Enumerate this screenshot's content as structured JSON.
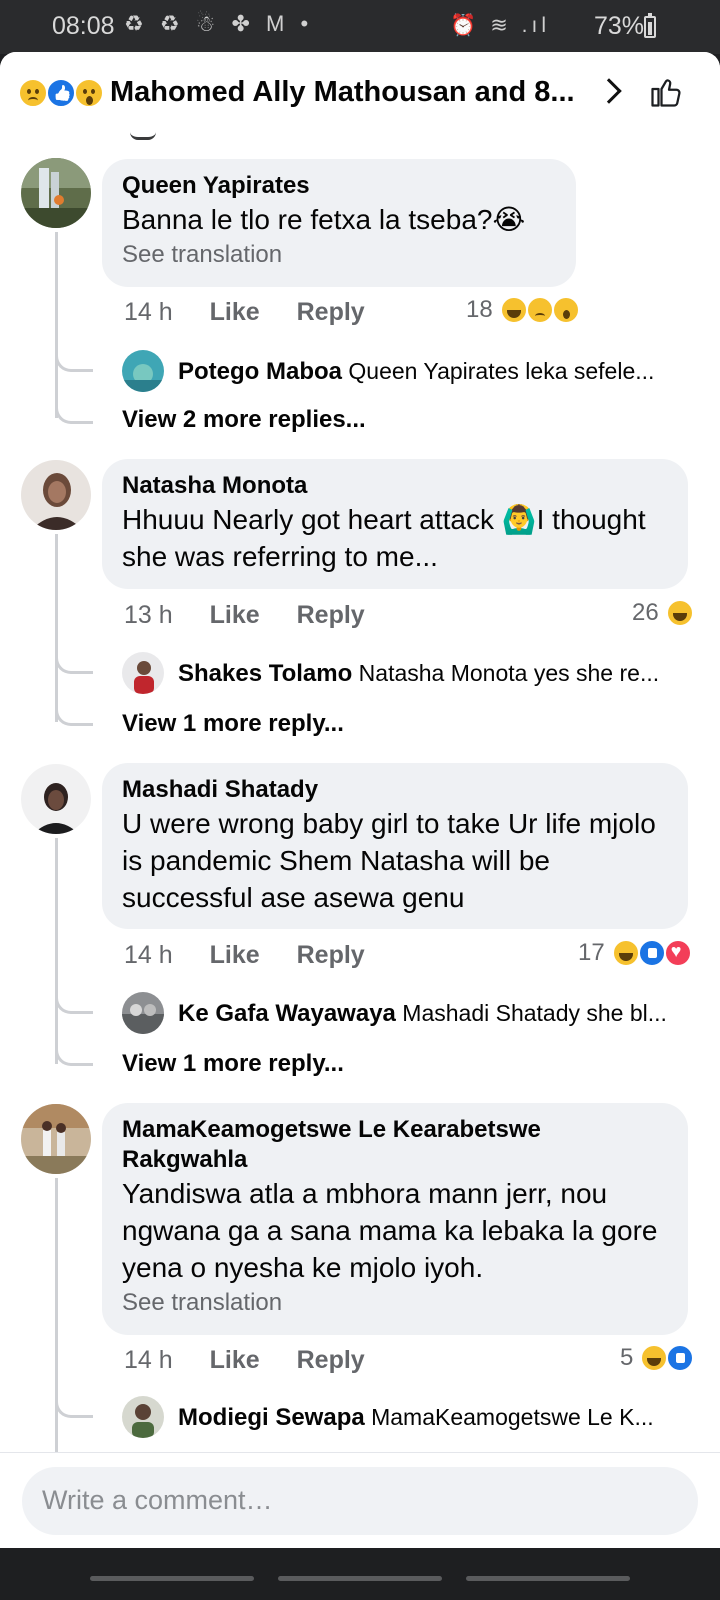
{
  "status_bar": {
    "time": "08:08",
    "left_icons": "♻ ♻ ☃ ✤ M •",
    "right_icons": "⏰ ≋ .ıl",
    "battery": "73%"
  },
  "header": {
    "title": "Mahomed Ally Mathousan and 8...",
    "reaction_icons": [
      "sad-icon",
      "like-icon",
      "wow-icon"
    ]
  },
  "comments": [
    {
      "author": "Queen Yapirates",
      "text": "Banna le tlo re fetxa la tseba?😭",
      "see_translation": "See translation",
      "time": "14 h",
      "like": "Like",
      "reply": "Reply",
      "reaction_count": "18",
      "reactions": [
        "haha",
        "sad",
        "wow"
      ],
      "replies_preview": {
        "author": "Potego Maboa",
        "text": "Queen Yapirates leka sefele..."
      },
      "view_more": "View 2 more replies..."
    },
    {
      "author": "Natasha Monota",
      "text": "Hhuuu Nearly got heart attack 🙆‍♂️I thought she was referring to me...",
      "time": "13 h",
      "like": "Like",
      "reply": "Reply",
      "reaction_count": "26",
      "reactions": [
        "haha"
      ],
      "replies_preview": {
        "author": "Shakes Tolamo",
        "text": "Natasha Monota yes she re..."
      },
      "view_more": "View 1 more reply..."
    },
    {
      "author": "Mashadi Shatady",
      "text": "U were wrong baby girl to take Ur life mjolo is pandemic Shem Natasha will be successful ase asewa genu",
      "time": "14 h",
      "like": "Like",
      "reply": "Reply",
      "reaction_count": "17",
      "reactions": [
        "haha",
        "like",
        "love"
      ],
      "replies_preview": {
        "author": "Ke Gafa Wayawaya",
        "text": "Mashadi Shatady she bl..."
      },
      "view_more": "View 1 more reply..."
    },
    {
      "author": "MamaKeamogetswe Le Kearabetswe Rakgwahla",
      "text": "Yandiswa atla a mbhora mann jerr, nou ngwana ga a sana mama ka lebaka la gore yena o nyesha ke mjolo iyoh.",
      "see_translation": "See translation",
      "time": "14 h",
      "like": "Like",
      "reply": "Reply",
      "reaction_count": "5",
      "reactions": [
        "haha",
        "like"
      ],
      "replies_preview": {
        "author": "Modiegi Sewapa",
        "text": "MamaKeamogetswe Le K..."
      }
    }
  ],
  "composer": {
    "placeholder": "Write a comment…"
  }
}
